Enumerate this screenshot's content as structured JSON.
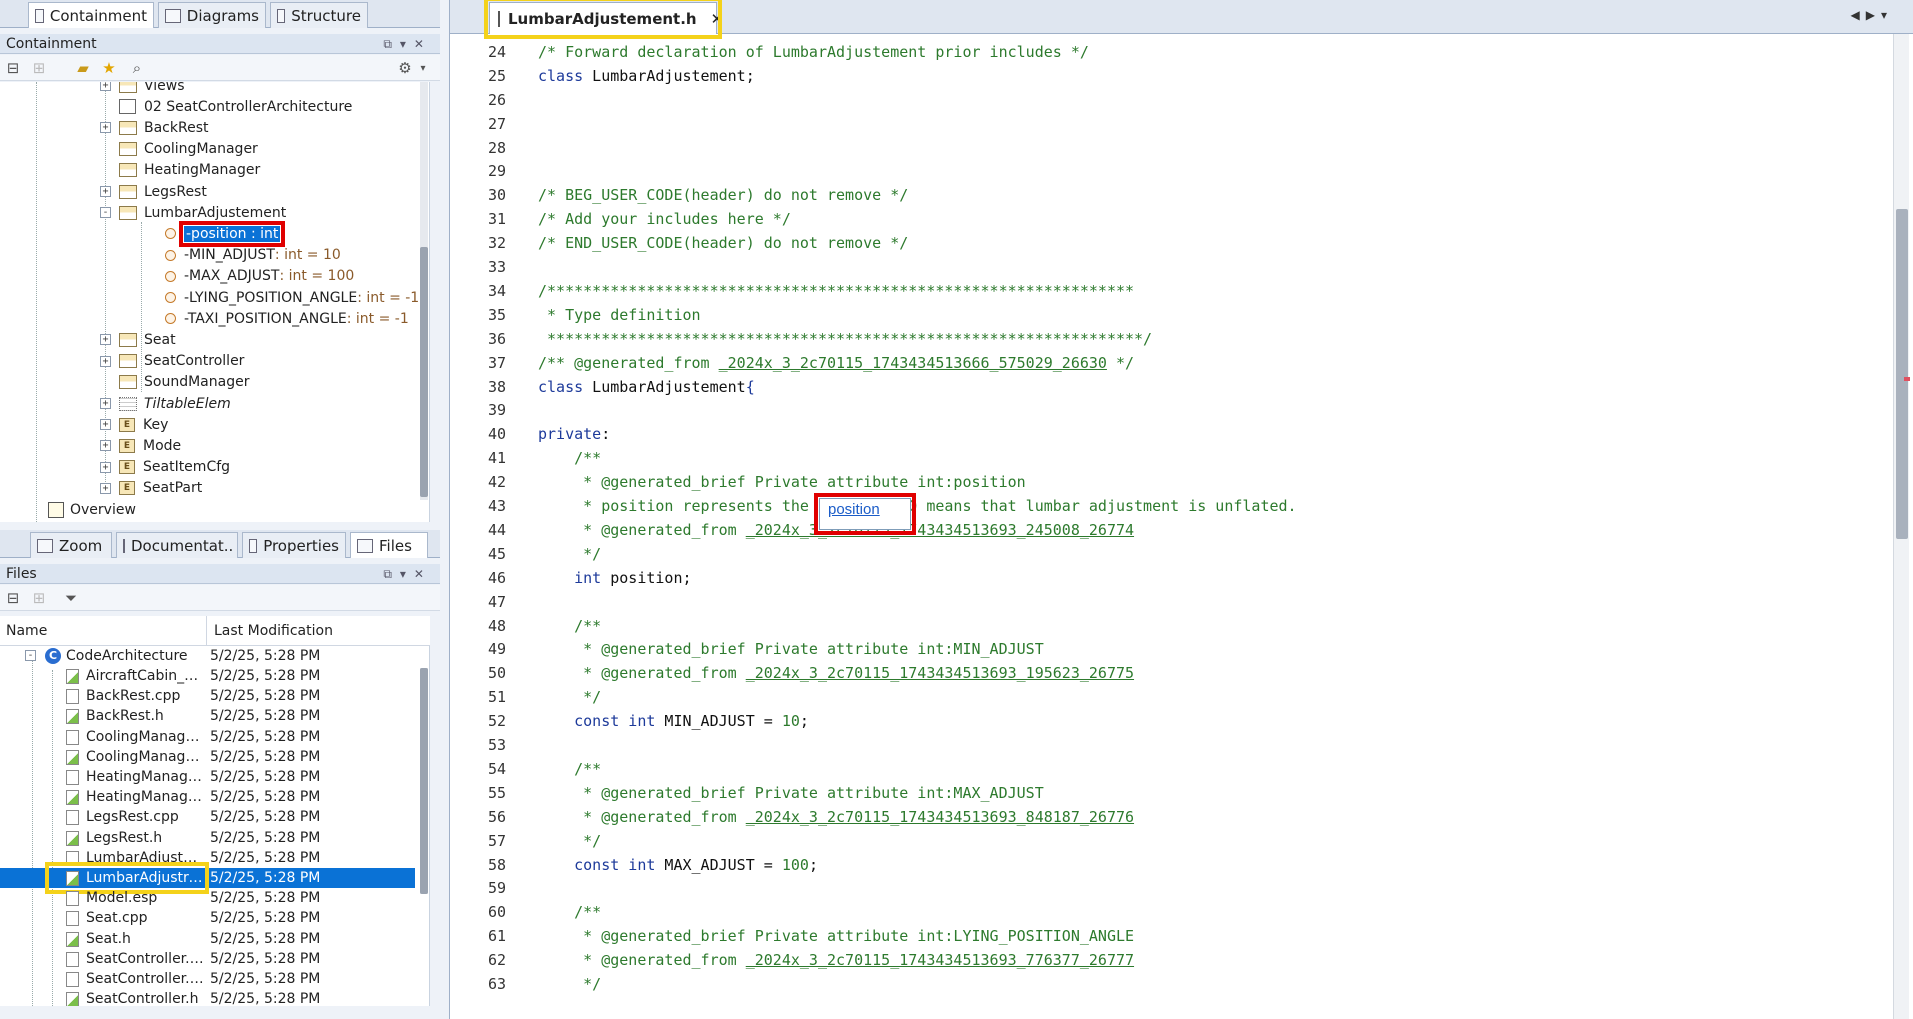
{
  "left_tabs": [
    "Containment",
    "Diagrams",
    "Structure"
  ],
  "containment": {
    "title": "Containment",
    "tree": [
      {
        "label": "Views",
        "kind": "folder",
        "depth": 0,
        "expander": "+"
      },
      {
        "label": "02 SeatControllerArchitecture",
        "kind": "diagram",
        "depth": 0
      },
      {
        "label": "BackRest",
        "kind": "class",
        "depth": 0,
        "expander": "+"
      },
      {
        "label": "CoolingManager",
        "kind": "class",
        "depth": 0
      },
      {
        "label": "HeatingManager",
        "kind": "class",
        "depth": 0
      },
      {
        "label": "LegsRest",
        "kind": "class",
        "depth": 0,
        "expander": "+"
      },
      {
        "label": "LumbarAdjustement",
        "kind": "class",
        "depth": 0,
        "expander": "-"
      },
      {
        "label": "-position",
        "type": " : int",
        "kind": "attr",
        "depth": 1,
        "selected": true
      },
      {
        "label": "-MIN_ADJUST",
        "type": " : int = 10",
        "kind": "attr",
        "depth": 1
      },
      {
        "label": "-MAX_ADJUST",
        "type": " : int = 100",
        "kind": "attr",
        "depth": 1
      },
      {
        "label": "-LYING_POSITION_ANGLE",
        "type": " : int = -1",
        "kind": "attr",
        "depth": 1
      },
      {
        "label": "-TAXI_POSITION_ANGLE",
        "type": " : int = -1",
        "kind": "attr",
        "depth": 1
      },
      {
        "label": "Seat",
        "kind": "class",
        "depth": 0,
        "expander": "+"
      },
      {
        "label": "SeatController",
        "kind": "class",
        "depth": 0,
        "expander": "+"
      },
      {
        "label": "SoundManager",
        "kind": "class",
        "depth": 0
      },
      {
        "label": "TiltableElem",
        "kind": "interface",
        "depth": 0,
        "expander": "+"
      },
      {
        "label": "Key",
        "kind": "enum",
        "depth": 0,
        "expander": "+"
      },
      {
        "label": "Mode",
        "kind": "enum",
        "depth": 0,
        "expander": "+"
      },
      {
        "label": "SeatItemCfg",
        "kind": "enum",
        "depth": 0,
        "expander": "+"
      },
      {
        "label": "SeatPart",
        "kind": "enum",
        "depth": 0,
        "expander": "+"
      }
    ],
    "overview": "Overview"
  },
  "bottom_tabs": [
    "Zoom",
    "Documentat..",
    "Properties",
    "Files"
  ],
  "files": {
    "title": "Files",
    "col_name": "Name",
    "col_modified": "Last Modification",
    "root": "CodeArchitecture",
    "root_date": "5/2/25, 5:28 PM",
    "rows": [
      {
        "name": "AircraftCabin_Se...",
        "date": "5/2/25, 5:28 PM",
        "icon": "h"
      },
      {
        "name": "BackRest.cpp",
        "date": "5/2/25, 5:28 PM",
        "icon": "cpp"
      },
      {
        "name": "BackRest.h",
        "date": "5/2/25, 5:28 PM",
        "icon": "h"
      },
      {
        "name": "CoolingManager...",
        "date": "5/2/25, 5:28 PM",
        "icon": "cpp"
      },
      {
        "name": "CoolingManager...",
        "date": "5/2/25, 5:28 PM",
        "icon": "h"
      },
      {
        "name": "HeatingManager...",
        "date": "5/2/25, 5:28 PM",
        "icon": "cpp"
      },
      {
        "name": "HeatingManager...",
        "date": "5/2/25, 5:28 PM",
        "icon": "h"
      },
      {
        "name": "LegsRest.cpp",
        "date": "5/2/25, 5:28 PM",
        "icon": "cpp"
      },
      {
        "name": "LegsRest.h",
        "date": "5/2/25, 5:28 PM",
        "icon": "h"
      },
      {
        "name": "LumbarAdjustme...",
        "date": "5/2/25, 5:28 PM",
        "icon": "cpp"
      },
      {
        "name": "LumbarAdjustre...",
        "date": "5/2/25, 5:28 PM",
        "icon": "h",
        "selected": true
      },
      {
        "name": "Model.esp",
        "date": "5/2/25, 5:28 PM",
        "icon": "cpp"
      },
      {
        "name": "Seat.cpp",
        "date": "5/2/25, 5:28 PM",
        "icon": "cpp"
      },
      {
        "name": "Seat.h",
        "date": "5/2/25, 5:28 PM",
        "icon": "h"
      },
      {
        "name": "SeatController.cp...",
        "date": "5/2/25, 5:28 PM",
        "icon": "cpp"
      },
      {
        "name": "SeatController.es...",
        "date": "5/2/25, 5:28 PM",
        "icon": "cpp"
      },
      {
        "name": "SeatController.h",
        "date": "5/2/25, 5:28 PM",
        "icon": "h"
      }
    ]
  },
  "editor": {
    "tab_title": "LumbarAdjustement.h",
    "close_glyph": "✕",
    "popup": "position",
    "lines": [
      {
        "n": "23",
        "segs": []
      },
      {
        "n": "24",
        "segs": [
          [
            "cmt",
            "/* Forward declaration of LumbarAdjustement prior includes */"
          ]
        ]
      },
      {
        "n": "25",
        "segs": [
          [
            "kw",
            "class"
          ],
          [
            "ident",
            " LumbarAdjustement;"
          ]
        ]
      },
      {
        "n": "26",
        "segs": []
      },
      {
        "n": "27",
        "segs": []
      },
      {
        "n": "28",
        "segs": []
      },
      {
        "n": "29",
        "segs": []
      },
      {
        "n": "30",
        "segs": [
          [
            "cmt",
            "/* BEG_USER_CODE(header) do not remove */"
          ]
        ]
      },
      {
        "n": "31",
        "segs": [
          [
            "cmt",
            "/* Add your includes here */"
          ]
        ]
      },
      {
        "n": "32",
        "segs": [
          [
            "cmt",
            "/* END_USER_CODE(header) do not remove */"
          ]
        ]
      },
      {
        "n": "33",
        "segs": []
      },
      {
        "n": "34",
        "segs": [
          [
            "cmt",
            "/*****************************************************************"
          ]
        ]
      },
      {
        "n": "35",
        "segs": [
          [
            "cmt",
            " * Type definition"
          ]
        ]
      },
      {
        "n": "36",
        "segs": [
          [
            "cmt",
            " ******************************************************************/"
          ]
        ]
      },
      {
        "n": "37",
        "segs": [
          [
            "cmt",
            "/** @generated_from "
          ],
          [
            "link",
            "_2024x_3_2c70115_1743434513666_575029_26630"
          ],
          [
            "cmt",
            " */"
          ]
        ]
      },
      {
        "n": "38",
        "segs": [
          [
            "kw",
            "class"
          ],
          [
            "ident",
            " LumbarAdjustement"
          ],
          [
            "kw",
            "{"
          ]
        ]
      },
      {
        "n": "39",
        "segs": []
      },
      {
        "n": "40",
        "segs": [
          [
            "kw",
            "private"
          ],
          [
            "ident",
            ":"
          ]
        ]
      },
      {
        "n": "41",
        "segs": [
          [
            "cmt",
            "    /**"
          ]
        ]
      },
      {
        "n": "42",
        "segs": [
          [
            "cmt",
            "     * @generated_brief Private attribute int:position"
          ]
        ]
      },
      {
        "n": "43",
        "segs": [
          [
            "cmt",
            "     * position represents the settings. 0 means that lumbar adjustment is unflated."
          ]
        ]
      },
      {
        "n": "44",
        "segs": [
          [
            "cmt",
            "     * @generated_from "
          ],
          [
            "link",
            "_2024x_3_2c70115_1743434513693_245008_26774"
          ]
        ]
      },
      {
        "n": "45",
        "segs": [
          [
            "cmt",
            "     */"
          ]
        ]
      },
      {
        "n": "46",
        "segs": [
          [
            "kw",
            "    int"
          ],
          [
            "ident",
            " position;"
          ]
        ]
      },
      {
        "n": "47",
        "segs": []
      },
      {
        "n": "48",
        "segs": [
          [
            "cmt",
            "    /**"
          ]
        ]
      },
      {
        "n": "49",
        "segs": [
          [
            "cmt",
            "     * @generated_brief Private attribute int:MIN_ADJUST"
          ]
        ]
      },
      {
        "n": "50",
        "segs": [
          [
            "cmt",
            "     * @generated_from "
          ],
          [
            "link",
            "_2024x_3_2c70115_1743434513693_195623_26775"
          ]
        ]
      },
      {
        "n": "51",
        "segs": [
          [
            "cmt",
            "     */"
          ]
        ]
      },
      {
        "n": "52",
        "segs": [
          [
            "kw",
            "    const int"
          ],
          [
            "ident",
            " MIN_ADJUST = "
          ],
          [
            "num",
            "10"
          ],
          [
            "ident",
            ";"
          ]
        ]
      },
      {
        "n": "53",
        "segs": []
      },
      {
        "n": "54",
        "segs": [
          [
            "cmt",
            "    /**"
          ]
        ]
      },
      {
        "n": "55",
        "segs": [
          [
            "cmt",
            "     * @generated_brief Private attribute int:MAX_ADJUST"
          ]
        ]
      },
      {
        "n": "56",
        "segs": [
          [
            "cmt",
            "     * @generated_from "
          ],
          [
            "link",
            "_2024x_3_2c70115_1743434513693_848187_26776"
          ]
        ]
      },
      {
        "n": "57",
        "segs": [
          [
            "cmt",
            "     */"
          ]
        ]
      },
      {
        "n": "58",
        "segs": [
          [
            "kw",
            "    const int"
          ],
          [
            "ident",
            " MAX_ADJUST = "
          ],
          [
            "num",
            "100"
          ],
          [
            "ident",
            ";"
          ]
        ]
      },
      {
        "n": "59",
        "segs": []
      },
      {
        "n": "60",
        "segs": [
          [
            "cmt",
            "    /**"
          ]
        ]
      },
      {
        "n": "61",
        "segs": [
          [
            "cmt",
            "     * @generated_brief Private attribute int:LYING_POSITION_ANGLE"
          ]
        ]
      },
      {
        "n": "62",
        "segs": [
          [
            "cmt",
            "     * @generated_from "
          ],
          [
            "link",
            "_2024x_3_2c70115_1743434513693_776377_26777"
          ]
        ]
      },
      {
        "n": "63",
        "segs": [
          [
            "cmt",
            "     */"
          ]
        ]
      }
    ]
  },
  "colors": {
    "selection": "#0a72d6",
    "highlight_red": "#e00000",
    "highlight_yellow": "#f4d21a",
    "comment": "#2d7a2d",
    "keyword": "#1d3a9a"
  }
}
